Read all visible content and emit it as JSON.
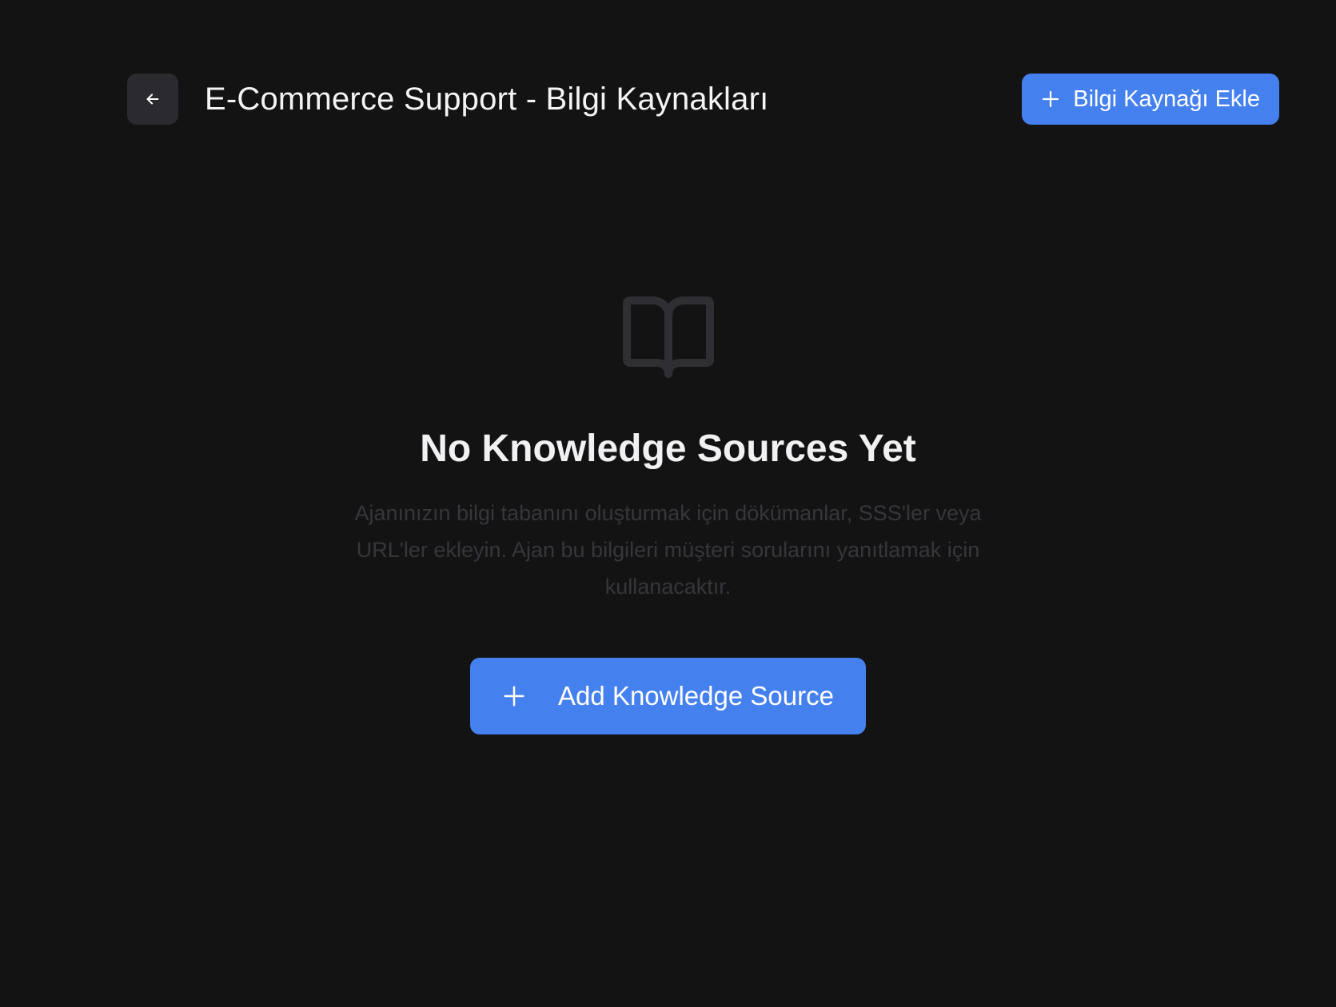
{
  "header": {
    "back_icon": "arrow-left-icon",
    "title": "E-Commerce Support - Bilgi Kaynakları",
    "add_button_icon": "plus-icon",
    "add_button_label": "Bilgi Kaynağı Ekle"
  },
  "empty_state": {
    "icon": "book-open-icon",
    "title": "No Knowledge Sources Yet",
    "description": "Ajanınızın bilgi tabanını oluşturmak için dökümanlar, SSS'ler veya URL'ler ekleyin. Ajan bu bilgileri müşteri sorularını yanıtlamak için kullanacaktır.",
    "add_button_icon": "plus-icon",
    "add_button_label": "Add Knowledge Source"
  },
  "colors": {
    "background": "#131314",
    "accent": "#4580ef",
    "back_button_bg": "#2a2a2f",
    "muted_text": "#36363b"
  }
}
